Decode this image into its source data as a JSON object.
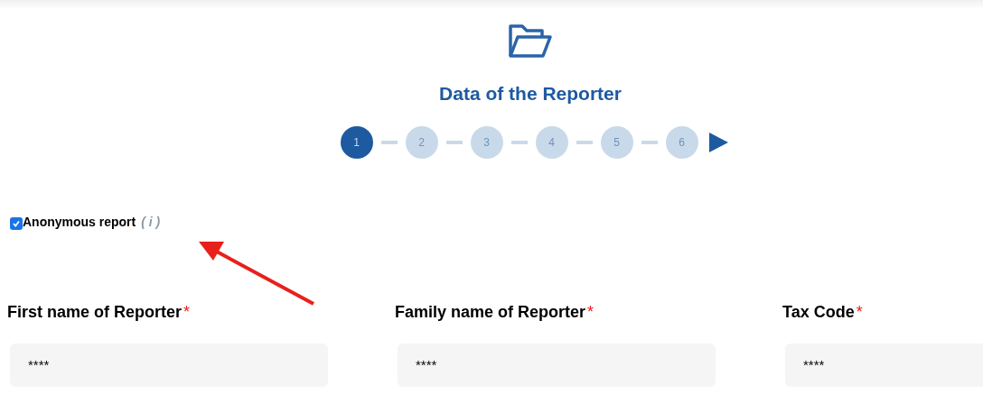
{
  "title": "Data of the Reporter",
  "steps": [
    {
      "label": "1",
      "selected": true
    },
    {
      "label": "2",
      "selected": false
    },
    {
      "label": "3",
      "selected": false
    },
    {
      "label": "4",
      "selected": false
    },
    {
      "label": "5",
      "selected": false
    },
    {
      "label": "6",
      "selected": false
    }
  ],
  "anonymous": {
    "label": "Anonymous report",
    "info": "( i )",
    "checked": true
  },
  "fields": [
    {
      "label": "First name of Reporter",
      "required_mark": "*",
      "value": "****"
    },
    {
      "label": "Family name of Reporter",
      "required_mark": "*",
      "value": "****"
    },
    {
      "label": "Tax Code",
      "required_mark": "*",
      "value": "****"
    }
  ]
}
